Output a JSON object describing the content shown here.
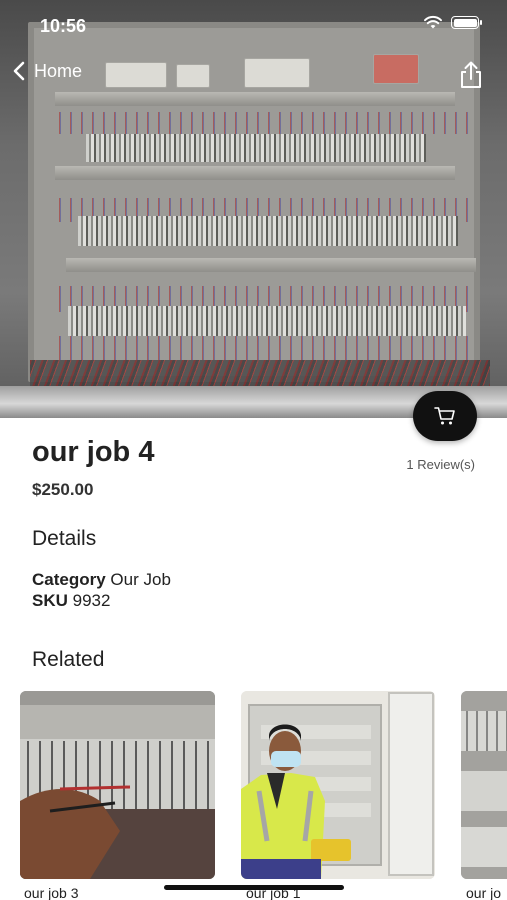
{
  "status_bar": {
    "time": "10:56"
  },
  "nav": {
    "back_label": "Home"
  },
  "product": {
    "title": "our job 4",
    "price": "$250.00",
    "reviews": "1 Review(s)"
  },
  "details": {
    "heading": "Details",
    "category_label": "Category",
    "category_value": "Our Job",
    "sku_label": "SKU",
    "sku_value": "9932"
  },
  "related": {
    "heading": "Related",
    "items": [
      {
        "caption": "our job 3"
      },
      {
        "caption": "our job 1"
      },
      {
        "caption": "our jo"
      }
    ]
  },
  "icons": {
    "back": "chevron-left-icon",
    "share": "share-icon",
    "cart": "cart-icon",
    "wifi": "wifi-icon",
    "battery": "battery-icon"
  },
  "colors": {
    "fab_background": "#111111",
    "text_primary": "#222222"
  }
}
